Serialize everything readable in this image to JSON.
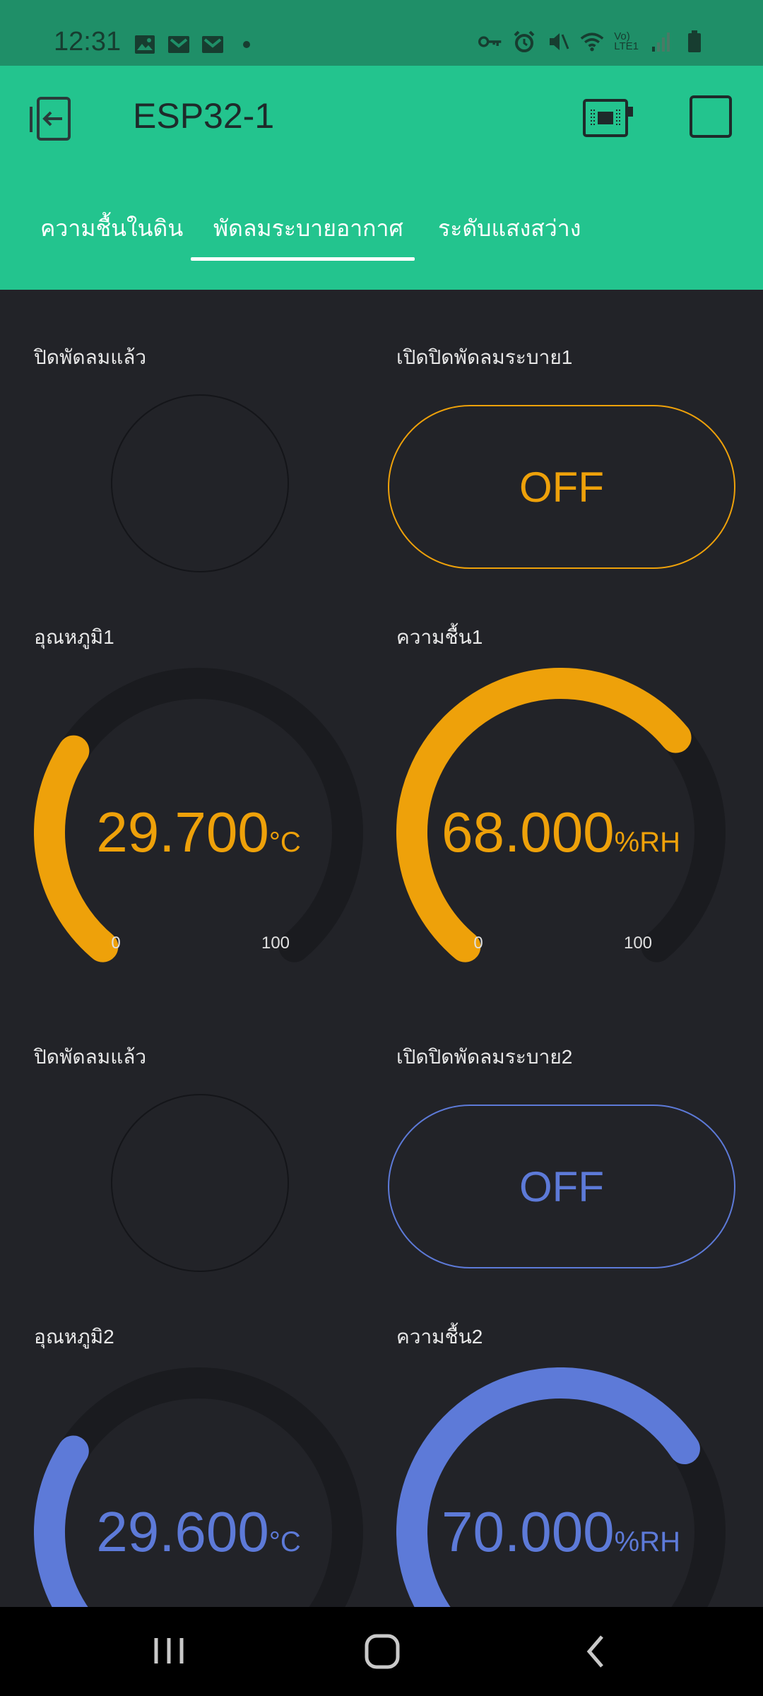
{
  "status_bar": {
    "time": "12:31",
    "network_label_1": "Vo)",
    "network_label_2": "LTE1",
    "left_icons": [
      "image-icon",
      "gmail-icon",
      "gmail-icon",
      "dot-icon"
    ],
    "right_icons": [
      "vpn-key-icon",
      "alarm-icon",
      "mute-icon",
      "wifi-icon",
      "signal-icon",
      "battery-icon"
    ]
  },
  "app_bar": {
    "title": "ESP32-1",
    "back_icon": "exit-icon",
    "device_icon": "board-icon",
    "square_icon": "stop-icon"
  },
  "tabs": [
    {
      "label": "ความชื้นในดิน",
      "active": false
    },
    {
      "label": "พัดลมระบายอากาศ",
      "active": true
    },
    {
      "label": "ระดับแสงสว่าง",
      "active": false
    }
  ],
  "widgets": {
    "led1_label": "ปิดพัดลมแล้ว",
    "button1_label": "เปิดปิดพัดลมระบาย1",
    "button1_state": "OFF",
    "button1_color": "#eea10a",
    "temp1": {
      "label": "อุณหภูมิ1",
      "value": "29.700",
      "unit": "°C",
      "min": "0",
      "max": "100",
      "level": 29.7,
      "color": "#eea10a"
    },
    "hum1": {
      "label": "ความชื้น1",
      "value": "68.000",
      "unit": "%RH",
      "min": "0",
      "max": "100",
      "level": 68.0,
      "color": "#eea10a"
    },
    "led2_label": "ปิดพัดลมแล้ว",
    "button2_label": "เปิดปิดพัดลมระบาย2",
    "button2_state": "OFF",
    "button2_color": "#5d7ad8",
    "temp2": {
      "label": "อุณหภูมิ2",
      "value": "29.600",
      "unit": "°C",
      "level": 29.6,
      "color": "#5d7ad8"
    },
    "hum2": {
      "label": "ความชื้น2",
      "value": "70.000",
      "unit": "%RH",
      "level": 70.0,
      "color": "#5d7ad8"
    }
  },
  "nav_bar": {
    "recent_icon": "recent-apps-icon",
    "home_icon": "home-icon",
    "back_icon": "back-icon"
  }
}
